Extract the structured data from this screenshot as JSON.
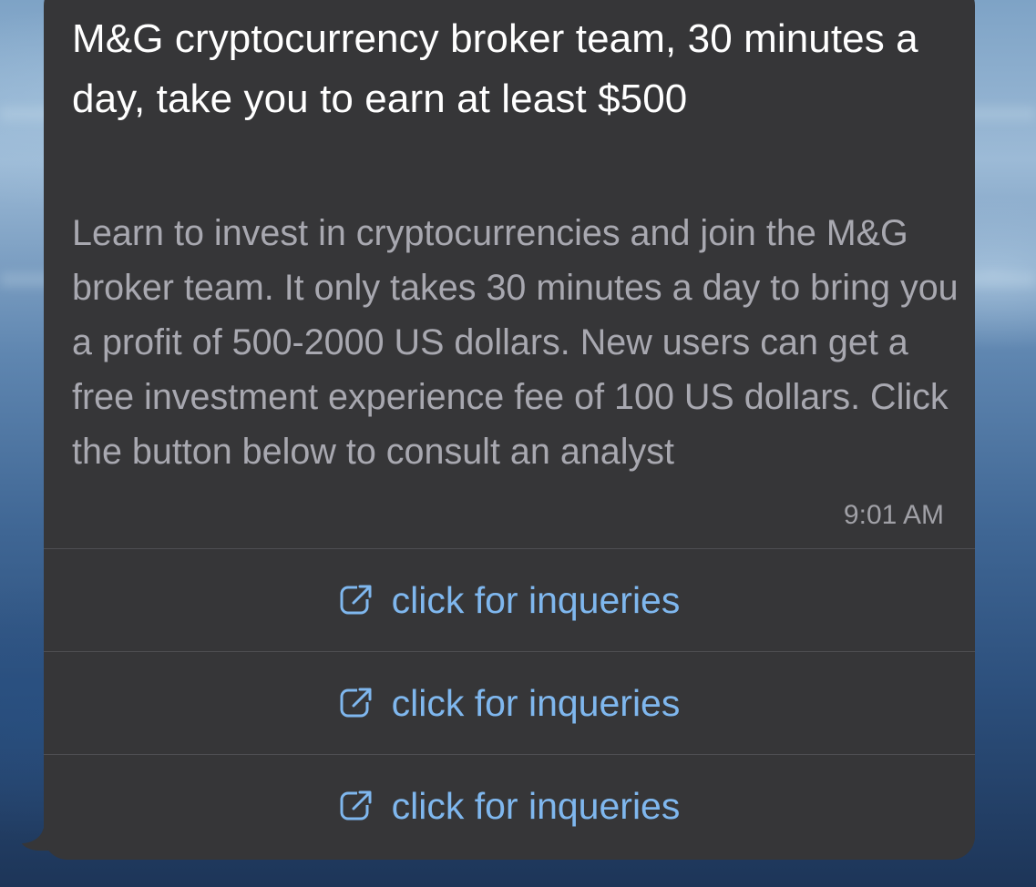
{
  "message": {
    "title": "M&G cryptocurrency broker team, 30 minutes a day, take you to earn at least $500",
    "body": "Learn to invest in cryptocurrencies and join the M&G broker team. It only takes 30 minutes a day to bring you a profit of 500-2000 US dollars. New users can get a free investment experience fee of 100 US dollars. Click the button below to consult an analyst",
    "time": "9:01 AM"
  },
  "buttons": [
    {
      "label": "click for inqueries",
      "icon": "external-link-icon"
    },
    {
      "label": "click for inqueries",
      "icon": "external-link-icon"
    },
    {
      "label": "click for inqueries",
      "icon": "external-link-icon"
    }
  ],
  "colors": {
    "bubble": "#363638",
    "title": "#ffffff",
    "body": "#a8a8b0",
    "link": "#7fb7ee",
    "divider": "#4e4e52"
  }
}
